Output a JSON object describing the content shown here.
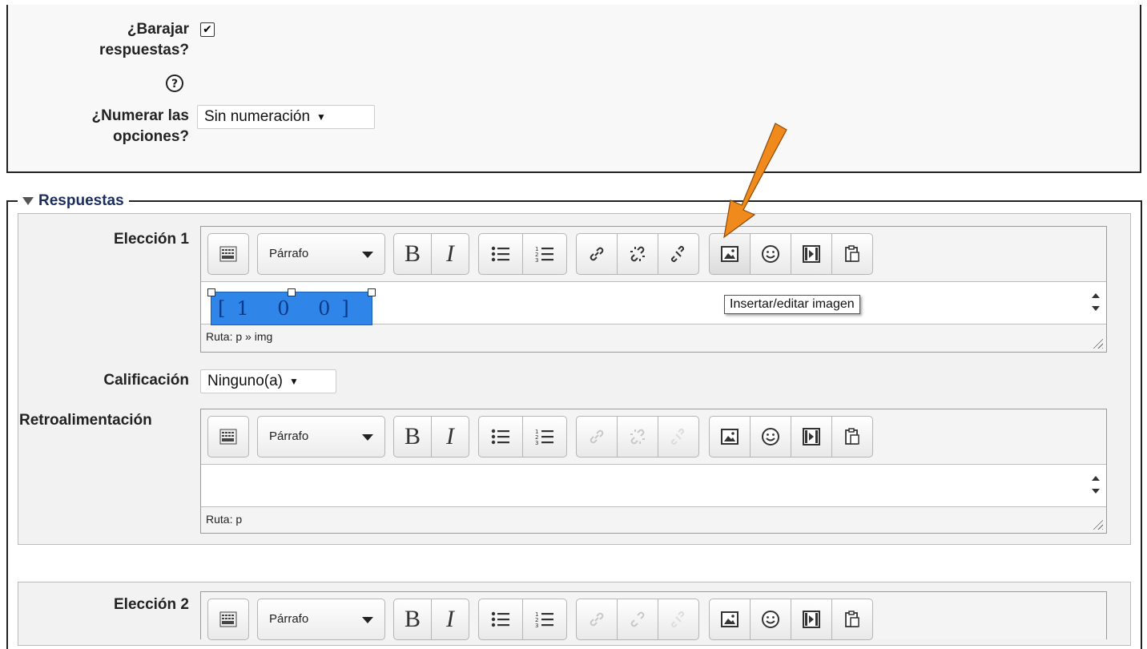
{
  "options": {
    "shuffle_label": "¿Barajar respuestas?",
    "shuffle_checked": true,
    "numbering_label": "¿Numerar las opciones?",
    "numbering_value": "Sin numeración"
  },
  "respuestas": {
    "legend": "Respuestas",
    "choice1": {
      "label": "Elección 1",
      "format": "Párrafo",
      "content_preview": "[1 0 0]",
      "path": "Ruta: p » img"
    },
    "grade": {
      "label": "Calificación",
      "value": "Ninguno(a)"
    },
    "feedback": {
      "label": "Retroalimentación",
      "format": "Párrafo",
      "path": "Ruta: p"
    },
    "choice2": {
      "label": "Elección 2",
      "format": "Párrafo"
    }
  },
  "tooltip": "Insertar/editar imagen",
  "toolbar_icons": [
    "toolbar-toggle-icon",
    "bold-icon",
    "italic-icon",
    "unordered-list-icon",
    "ordered-list-icon",
    "link-icon",
    "unlink-icon",
    "nolink-icon",
    "image-icon",
    "emoticon-icon",
    "media-icon",
    "paste-icon"
  ],
  "colors": {
    "arrow": "#f08a1c",
    "legend": "#1b2d5c",
    "selection": "#2f86e8"
  }
}
